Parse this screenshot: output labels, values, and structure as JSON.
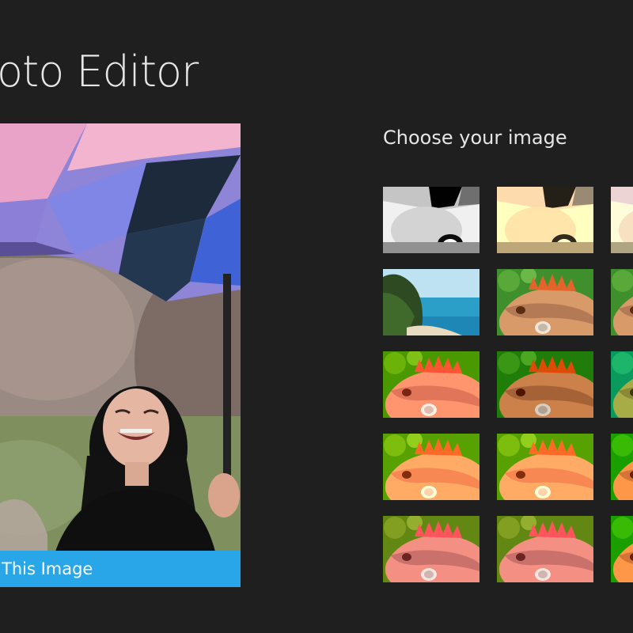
{
  "app": {
    "title": "oto Editor"
  },
  "preview": {
    "use_button_label": "This Image"
  },
  "chooser": {
    "heading": "Choose your image",
    "thumbnails": [
      {
        "name": "thumb-bw-umbrella",
        "scene": "umbrella",
        "filter": "bw"
      },
      {
        "name": "thumb-sepia-umbrella",
        "scene": "umbrella",
        "filter": "sepia"
      },
      {
        "name": "thumb-umbrella-3",
        "scene": "umbrella",
        "filter": "sepia2"
      },
      {
        "name": "thumb-beach",
        "scene": "beach",
        "filter": "none"
      },
      {
        "name": "thumb-iguana-green",
        "scene": "iguana",
        "filter": "none"
      },
      {
        "name": "thumb-iguana-green-3",
        "scene": "iguana",
        "filter": "none"
      },
      {
        "name": "thumb-iguana-warm",
        "scene": "iguana",
        "filter": "warm"
      },
      {
        "name": "thumb-iguana-dark",
        "scene": "iguana",
        "filter": "dark"
      },
      {
        "name": "thumb-iguana-teal",
        "scene": "iguana",
        "filter": "teal"
      },
      {
        "name": "thumb-iguana-yellow",
        "scene": "iguana",
        "filter": "yellow"
      },
      {
        "name": "thumb-iguana-yellow-2",
        "scene": "iguana",
        "filter": "yellow"
      },
      {
        "name": "thumb-iguana-vivid",
        "scene": "iguana",
        "filter": "vivid"
      },
      {
        "name": "thumb-iguana-cool",
        "scene": "iguana",
        "filter": "cool"
      },
      {
        "name": "thumb-iguana-cool-2",
        "scene": "iguana",
        "filter": "cool"
      },
      {
        "name": "thumb-iguana-vivid-2",
        "scene": "iguana",
        "filter": "vivid"
      }
    ]
  },
  "colors": {
    "background": "#1f1f1f",
    "accent": "#29a6e8",
    "text": "#e6e6e6"
  }
}
